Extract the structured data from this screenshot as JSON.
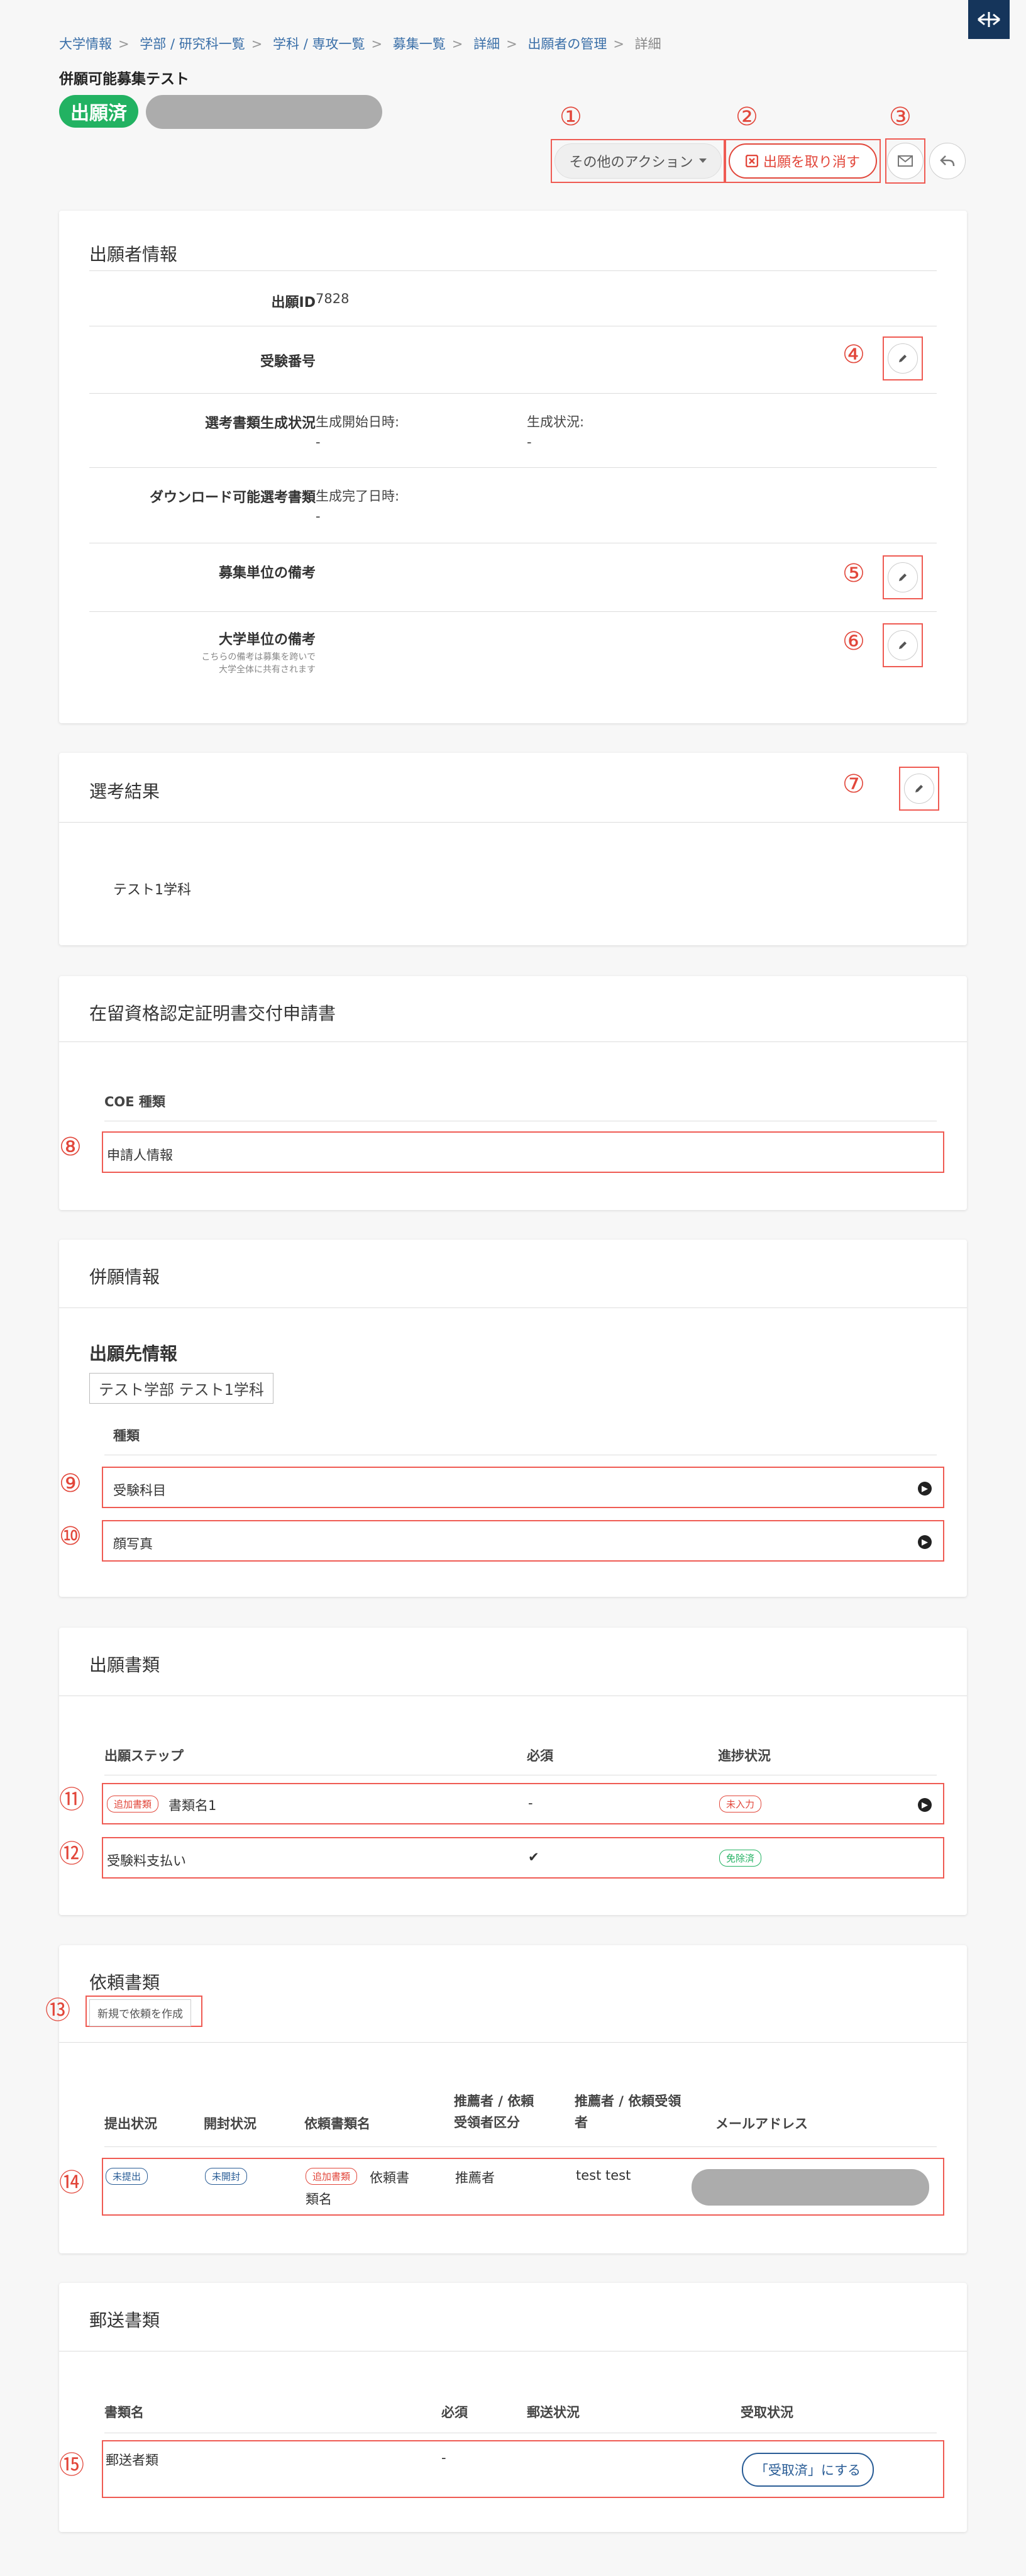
{
  "breadcrumb": [
    "大学情報",
    "学部 / 研究科一覧",
    "学科 / 専攻一覧",
    "募集一覧",
    "詳細",
    "出願者の管理",
    "詳細"
  ],
  "breadcrumb_sep": ">",
  "page_title": "併願可能募集テスト",
  "status_badge": "出願済",
  "markers": [
    "①",
    "②",
    "③",
    "④",
    "⑤",
    "⑥",
    "⑦",
    "⑧",
    "⑨",
    "⑩",
    "⑪",
    "⑫",
    "⑬",
    "⑭",
    "⑮"
  ],
  "actions": {
    "more_label": "その他のアクション",
    "cancel_label": "出願を取り消す"
  },
  "applicant": {
    "title": "出願者情報",
    "id_label": "出願ID",
    "id_value": "7828",
    "exam_no_label": "受験番号",
    "gen_label": "選考書類生成状況",
    "gen_start_label": "生成開始日時:",
    "gen_start_value": "-",
    "gen_status_label": "生成状況:",
    "gen_status_value": "-",
    "download_label": "ダウンロード可能選考書類",
    "gen_done_label": "生成完了日時:",
    "gen_done_value": "-",
    "unit_note_label": "募集単位の備考",
    "univ_note_label": "大学単位の備考",
    "univ_note_sub1": "こちらの備考は募集を跨いで",
    "univ_note_sub2": "大学全体に共有されます"
  },
  "selection": {
    "title": "選考結果",
    "value": "テスト1学科"
  },
  "coe": {
    "title": "在留資格認定証明書交付申請書",
    "column": "COE 種類",
    "row": "申請人情報"
  },
  "joint": {
    "title": "併願情報",
    "dest_title": "出願先情報",
    "dest_tag": "テスト学部 テスト1学科",
    "column": "種類",
    "rows": [
      "受験科目",
      "顔写真"
    ]
  },
  "docs": {
    "title": "出願書類",
    "columns": [
      "出願ステップ",
      "必須",
      "進捗状況"
    ],
    "rows": [
      {
        "tag": "追加書類",
        "name": "書類名1",
        "required": "-",
        "status": "未入力"
      },
      {
        "name": "受験料支払い",
        "required": "✔",
        "status": "免除済"
      }
    ]
  },
  "request": {
    "title": "依頼書類",
    "create_label": "新規で依頼を作成",
    "columns": [
      "提出状況",
      "開封状況",
      "依頼書類名",
      "推薦者 / 依頼",
      "受領者区分",
      "推薦者 / 依頼受領",
      "者",
      "メールアドレス"
    ],
    "row": {
      "submit": "未提出",
      "open": "未開封",
      "tag": "追加書類",
      "name1": "依頼書",
      "name2": "類名",
      "type": "推薦者",
      "recipient": "test test"
    }
  },
  "mail": {
    "title": "郵送書類",
    "columns": [
      "書類名",
      "必須",
      "郵送状況",
      "受取状況"
    ],
    "row": {
      "name": "郵送者類",
      "required": "-",
      "button": "「受取済」にする"
    }
  }
}
